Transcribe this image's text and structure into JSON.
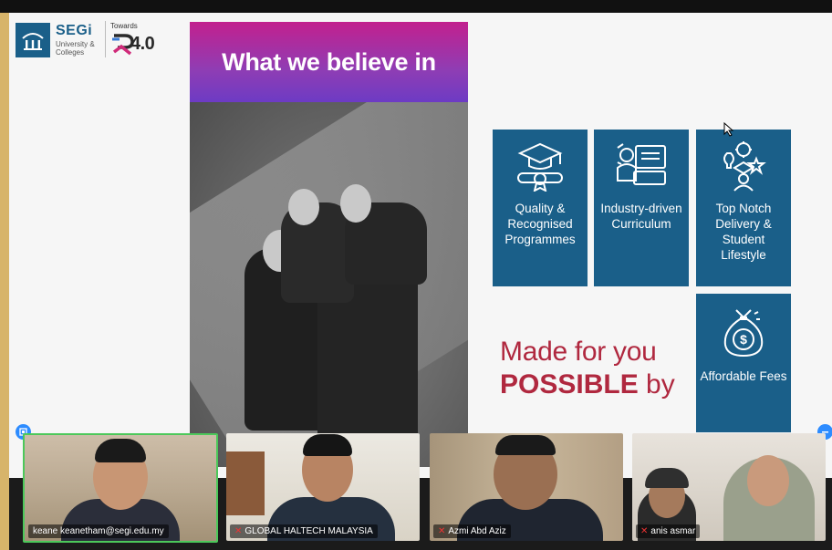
{
  "logo": {
    "name": "SEGi",
    "sub": "University & Colleges",
    "towards": "Towards",
    "ir": "4.0",
    "brand_color": "#1a5f89"
  },
  "slide": {
    "title": "What we believe in",
    "tiles": [
      {
        "label": "Quality & Recognised Programmes",
        "icon": "graduation-diploma-icon"
      },
      {
        "label": "Industry-driven Curriculum",
        "icon": "industry-worker-icon"
      },
      {
        "label": "Top Notch Delivery & Student Lifestyle",
        "icon": "student-lifestyle-icon"
      },
      {
        "label": "Affordable Fees",
        "icon": "money-bag-icon"
      }
    ],
    "tagline_line1": "Made for you",
    "tagline_bold": "POSSIBLE",
    "tagline_rest": "by",
    "tile_color": "#1a5f89",
    "accent_color": "#b0283f"
  },
  "participants": [
    {
      "name": "keane keanetham@segi.edu.my",
      "muted": false,
      "active": true
    },
    {
      "name": "GLOBAL HALTECH MALAYSIA",
      "muted": true,
      "active": false
    },
    {
      "name": "Azmi Abd Aziz",
      "muted": true,
      "active": false
    },
    {
      "name": "anis asmar",
      "muted": true,
      "active": false
    }
  ]
}
